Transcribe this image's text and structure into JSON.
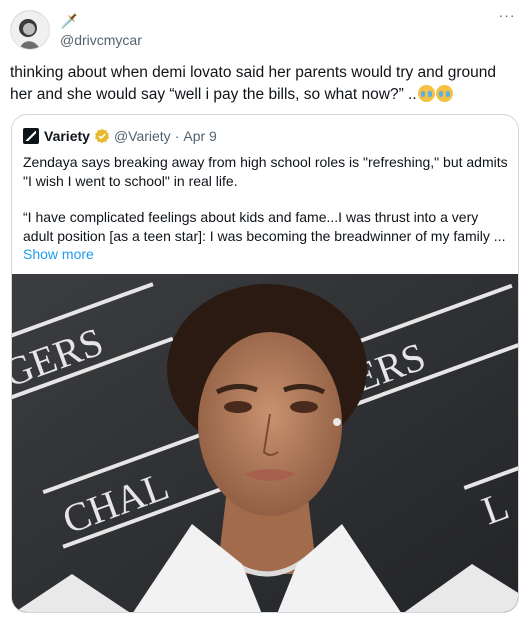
{
  "tweet": {
    "handle": "@drivcmycar",
    "name_icon": "dagger-icon",
    "text": "thinking about when demi lovato said her parents would try and ground her and she would say “well i pay the bills, so what now?” ..",
    "emojis": [
      "loudly-crying-face",
      "loudly-crying-face"
    ]
  },
  "quote": {
    "name": "Variety",
    "handle": "@Variety",
    "dot": "·",
    "date": "Apr 9",
    "paragraph1": "Zendaya says breaking away from high school roles is \"refreshing,\" but admits \"I wish I went to school\" in real life.",
    "paragraph2": "“I have complicated feelings about kids and fame...I was thrust into a very adult position [as a teen star]: I was becoming the breadwinner of my family ...",
    "show_more": "Show more",
    "photo": {
      "backdrop_text_1": "GERS",
      "backdrop_text_2": "ERS",
      "backdrop_text_3": "CHAL",
      "backdrop_text_4": "L"
    }
  },
  "colors": {
    "link": "#1d9bf0",
    "secondary_text": "#536471",
    "border": "#cfd9de",
    "verified_gold": "#e8b829"
  }
}
